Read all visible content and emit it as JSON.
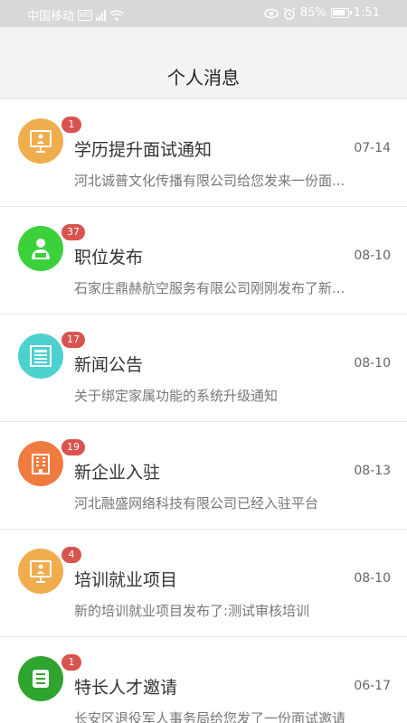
{
  "status_bar": {
    "carrier": "中国移动",
    "hd": "HD",
    "battery": "85%",
    "time": "1:51"
  },
  "header": {
    "title": "个人消息"
  },
  "messages": [
    {
      "title": "学历提升面试通知",
      "date": "07-14",
      "preview": "河北诚普文化传播有限公司给您发来一份面...",
      "badge": "1",
      "icon": "presentation-icon",
      "color": "#f0ad4e"
    },
    {
      "title": "职位发布",
      "date": "08-10",
      "preview": "石家庄鼎赫航空服务有限公司刚刚发布了新...",
      "badge": "37",
      "icon": "person-icon",
      "color": "#3bd13b"
    },
    {
      "title": "新闻公告",
      "date": "08-10",
      "preview": "关于绑定家属功能的系统升级通知",
      "badge": "17",
      "icon": "newspaper-icon",
      "color": "#4dd0d0"
    },
    {
      "title": "新企业入驻",
      "date": "08-13",
      "preview": "河北融盛网络科技有限公司已经入驻平台",
      "badge": "19",
      "icon": "building-icon",
      "color": "#f07b3f"
    },
    {
      "title": "培训就业项目",
      "date": "08-10",
      "preview": "新的培训就业项目发布了:测试审核培训",
      "badge": "4",
      "icon": "presentation-icon",
      "color": "#f0ad4e"
    },
    {
      "title": "特长人才邀请",
      "date": "06-17",
      "preview": "长安区退役军人事务局给您发了一份面试邀请",
      "badge": "1",
      "icon": "list-icon",
      "color": "#2fa52f"
    }
  ]
}
